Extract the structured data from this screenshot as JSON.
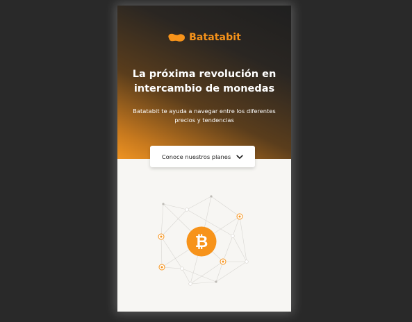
{
  "brand": {
    "name": "Batatabit",
    "accent_color": "#f7931a",
    "logo_icon": "batata-logo-icon"
  },
  "hero": {
    "title_line1": "La próxima revolución en",
    "title_line2": "intercambio de monedas",
    "subtitle_line1": "Batatabit te ayuda a navegar entre los diferentes",
    "subtitle_line2": "precios y tendencias",
    "cta_label": "Conoce nuestros planes",
    "cta_icon": "chevron-down-icon"
  },
  "illustration": {
    "center_icon": "bitcoin-icon",
    "center_symbol": "₿"
  }
}
